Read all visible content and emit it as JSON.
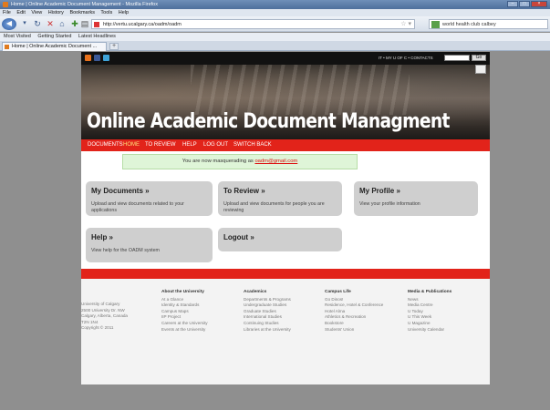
{
  "browser": {
    "window_title": "Home | Online Academic Document Management - Mozilla Firefox",
    "menu": [
      "File",
      "Edit",
      "View",
      "History",
      "Bookmarks",
      "Tools",
      "Help"
    ],
    "url": "http://vertu.ucalgary.ca/oadm/oadm",
    "search_value": "world health club calbey",
    "bookmarks": [
      "Most Visited",
      "Getting Started",
      "Latest Headlines"
    ],
    "tab_label": "Home | Online Academic Document ...",
    "new_tab": "+"
  },
  "site": {
    "top_links": "IT • MY U OF C • CONTACTS",
    "go_label": "Go",
    "title": "Online Academic Document Managment",
    "nav": [
      "DOCUMENTS",
      "HOME",
      "TO REVIEW",
      "HELP",
      "LOG OUT",
      "SWITCH BACK"
    ],
    "active_nav": "HOME",
    "notice_prefix": "You are now masquerading as ",
    "notice_email": "oadm@gmail.com"
  },
  "cards": [
    {
      "title": "My Documents »",
      "desc": "Upload and view documents related to your applications"
    },
    {
      "title": "To Review »",
      "desc": "Upload and view documents for people you are reviewing"
    },
    {
      "title": "My Profile »",
      "desc": "View your profile information"
    },
    {
      "title": "Help »",
      "desc": "View help for the OADM system"
    },
    {
      "title": "Logout »",
      "desc": ""
    }
  ],
  "footer": {
    "address": [
      "University of Calgary",
      "2500 University Dr. NW",
      "Calgary, Alberta, Canada",
      "T2N 1N4",
      "",
      "Copyright © 2011"
    ],
    "columns": [
      {
        "heading": "About the University",
        "items": [
          "At a Glance",
          "Identity & Standards",
          "Campus Maps",
          "IIP Project",
          "Careers at the University",
          "Events at the University"
        ]
      },
      {
        "heading": "Academics",
        "items": [
          "Departments & Programs",
          "Undergraduate Studies",
          "Graduate Studies",
          "International Studies",
          "Continuing Studies",
          "Libraries at the University"
        ]
      },
      {
        "heading": "Campus Life",
        "items": [
          "Go Dinos!",
          "Residence, Hotel & Conference",
          "Hotel Alma",
          "Athletics & Recreation",
          "Bookstore",
          "Students' Union"
        ]
      },
      {
        "heading": "Media & Publications",
        "items": [
          "News",
          "Media Centre",
          "U Today",
          "U This Week",
          "U Magazine",
          "University Calendar"
        ]
      }
    ]
  }
}
